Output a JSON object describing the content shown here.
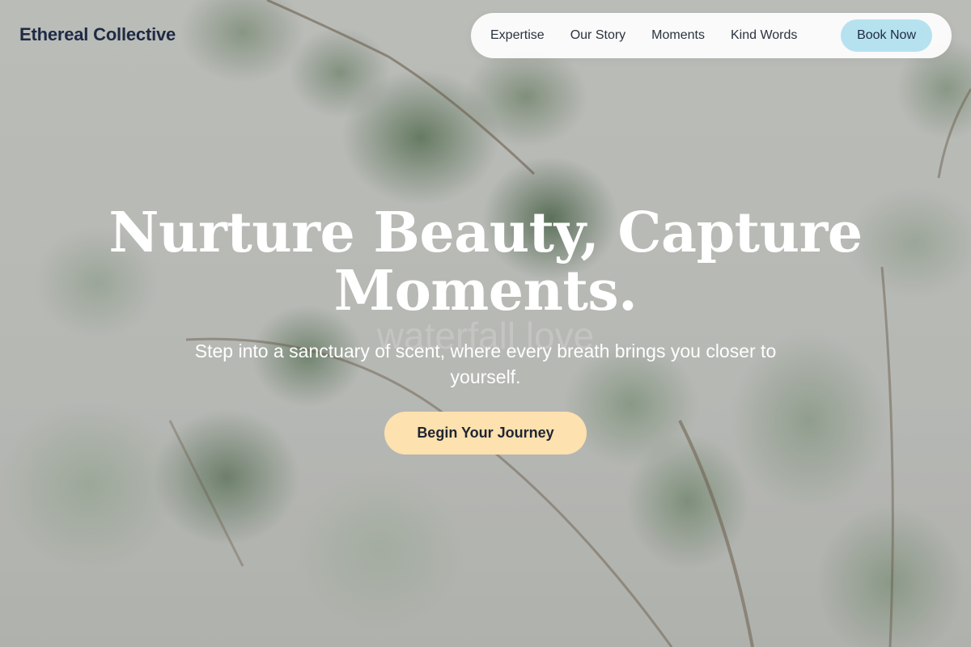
{
  "header": {
    "brand": "Ethereal Collective",
    "nav": [
      {
        "label": "Expertise"
      },
      {
        "label": "Our Story"
      },
      {
        "label": "Moments"
      },
      {
        "label": "Kind Words"
      }
    ],
    "book_label": "Book Now"
  },
  "hero": {
    "title_line1": "Nurture Beauty, Capture",
    "title_line2": "Moments.",
    "watermark": "waterfall love",
    "subtitle": "Step into a sanctuary of scent, where every breath brings you closer to yourself.",
    "cta_label": "Begin Your Journey"
  },
  "colors": {
    "brand_text": "#1f2a44",
    "book_button": "#b6e2ef",
    "cta_button": "#fde1ae"
  }
}
